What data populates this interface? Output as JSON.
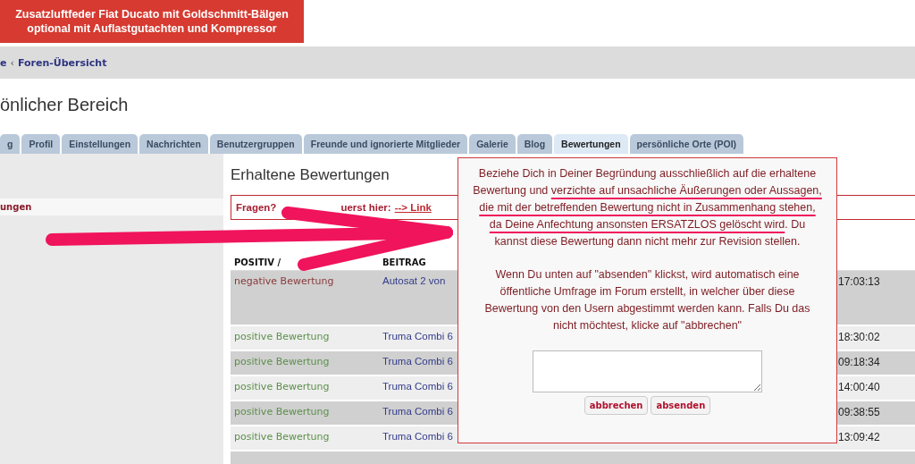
{
  "banner": {
    "lines": [
      "Zusatzluftfeder Fiat Ducato mit Goldschmitt-Bälgen",
      "optional mit Auflastgutachten und Kompressor"
    ]
  },
  "breadcrumb": {
    "items": [
      "e",
      "Foren-Übersicht"
    ],
    "separator": "‹"
  },
  "page_title": "önlicher Bereich",
  "tabs": [
    {
      "label": "g",
      "selected": false
    },
    {
      "label": "Profil",
      "selected": false
    },
    {
      "label": "Einstellungen",
      "selected": false
    },
    {
      "label": "Nachrichten",
      "selected": false
    },
    {
      "label": "Benutzergruppen",
      "selected": false
    },
    {
      "label": "Freunde und ignorierte Mitglieder",
      "selected": false
    },
    {
      "label": "Galerie",
      "selected": false
    },
    {
      "label": "Blog",
      "selected": false
    },
    {
      "label": "Bewertungen",
      "selected": true
    },
    {
      "label": "persönliche Orte (POI)",
      "selected": false
    }
  ],
  "sidebar": {
    "items": [
      {
        "label": "ungen",
        "selected": true
      }
    ]
  },
  "section_title": "Erhaltene Bewertungen",
  "notice": {
    "parts": [
      "Fragen?",
      "uerst hier:"
    ],
    "link": "--> Link"
  },
  "table": {
    "columns": [
      "POSITIV /",
      "BEITRAG"
    ],
    "rows": [
      {
        "kind": "negative",
        "rating": "negative Bewertung",
        "post": "Autosat 2 von",
        "time": "17:03:13"
      },
      {
        "kind": "positive",
        "rating": "positive Bewertung",
        "post": "Truma Combi 6",
        "time": "18:30:02"
      },
      {
        "kind": "positive",
        "rating": "positive Bewertung",
        "post": "Truma Combi 6",
        "time": "09:18:34"
      },
      {
        "kind": "positive",
        "rating": "positive Bewertung",
        "post": "Truma Combi 6",
        "time": "14:00:40"
      },
      {
        "kind": "positive",
        "rating": "positive Bewertung",
        "post": "Truma Combi 6",
        "time": "09:38:55"
      },
      {
        "kind": "positive",
        "rating": "positive Bewertung",
        "post": "Truma Combi 6",
        "time": "13:09:42"
      }
    ]
  },
  "dialog": {
    "paragraphs": [
      {
        "segments": [
          {
            "text": "Beziehe Dich in Deiner Begründung ausschließlich auf die erhaltene Bewertung und ",
            "marked": false
          },
          {
            "text": "verzichte auf unsachliche Äußerungen oder Aussagen, die mit der betreffenden Bewertung nicht in Zusammenhang stehen, da Deine Anfechtung ansonsten ERSATZLOS gelöscht wird",
            "marked": true
          },
          {
            "text": ". Du kannst diese Bewertung dann nicht mehr zur Revision stellen.",
            "marked": false
          }
        ]
      },
      {
        "segments": [
          {
            "text": "Wenn Du unten auf \"absenden\" klickst, wird automatisch eine öffentliche Umfrage im Forum erstellt, in welcher über diese Bewertung von den Usern abgestimmt werden kann. Falls Du das nicht möchtest, klicke auf \"abbrechen\"",
            "marked": false
          }
        ]
      }
    ],
    "buttons": [
      "abbrechen",
      "absenden"
    ]
  }
}
